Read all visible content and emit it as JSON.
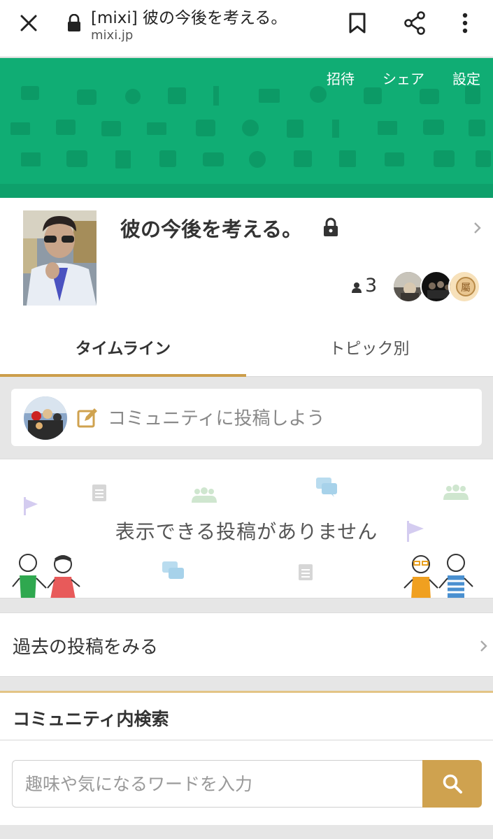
{
  "browser": {
    "title": "[mixi] 彼の今後を考える。",
    "url": "mixi.jp",
    "icons": [
      "close-icon",
      "lock-icon",
      "bookmark-icon",
      "share-icon",
      "more-vert-icon"
    ]
  },
  "banner": {
    "links": [
      "招待",
      "シェア",
      "設定"
    ],
    "color": "#10ad74"
  },
  "community": {
    "name": "彼の今後を考える。",
    "member_count": "3"
  },
  "tabs": {
    "timeline": "タイムライン",
    "by_topic": "トピック別"
  },
  "post_prompt": "コミュニティに投稿しよう",
  "empty_message": "表示できる投稿がありません",
  "past_posts_label": "過去の投稿をみる",
  "search": {
    "title": "コミュニティ内検索",
    "placeholder": "趣味や気になるワードを入力"
  },
  "colors": {
    "accent": "#cfa24f",
    "brand_green": "#10ad74"
  }
}
